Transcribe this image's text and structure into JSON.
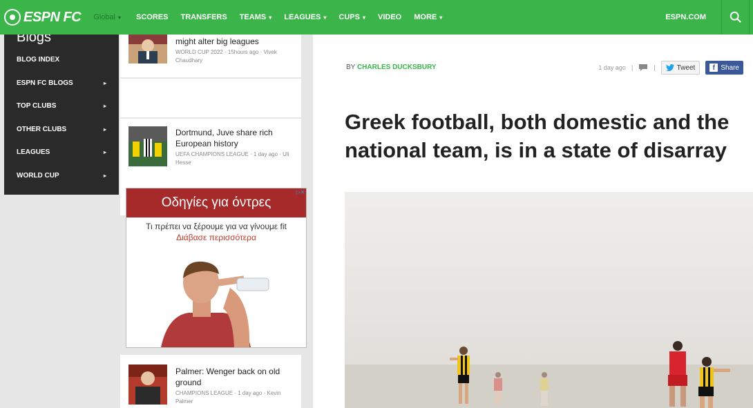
{
  "topbar": {
    "logo_text": "ESPN FC",
    "edition": "Global",
    "nav": [
      {
        "label": "SCORES",
        "dropdown": false
      },
      {
        "label": "TRANSFERS",
        "dropdown": false
      },
      {
        "label": "TEAMS",
        "dropdown": true
      },
      {
        "label": "LEAGUES",
        "dropdown": true
      },
      {
        "label": "CUPS",
        "dropdown": true
      },
      {
        "label": "VIDEO",
        "dropdown": false
      },
      {
        "label": "MORE",
        "dropdown": true
      }
    ],
    "espn_link": "ESPN.COM",
    "accent_color": "#3bb54a"
  },
  "sidebar": {
    "title": "Blogs",
    "items": [
      {
        "label": "BLOG INDEX",
        "arrow": false
      },
      {
        "label": "ESPN FC BLOGS",
        "arrow": true
      },
      {
        "label": "TOP CLUBS",
        "arrow": true
      },
      {
        "label": "OTHER CLUBS",
        "arrow": true
      },
      {
        "label": "LEAGUES",
        "arrow": true
      },
      {
        "label": "WORLD CUP",
        "arrow": true
      }
    ]
  },
  "stories": [
    {
      "title": "might alter big leagues",
      "meta": "WORLD CUP 2022 · 15hours ago · Vivek Chaudhary"
    },
    {
      "title": "Dortmund, Juve share rich European history",
      "meta": "UEFA CHAMPIONS LEAGUE · 1 day ago · Uli Hesse"
    },
    {
      "title": "Palmer: Wenger back on old ground",
      "meta": "CHAMPIONS LEAGUE · 1 day ago · Kevin Palmer"
    }
  ],
  "ad": {
    "header": "Οδηγίες για όντρες",
    "sub": "Τι πρέπει να ξέρουμε για να γίνουμε fit",
    "cta": "Διάβασε περισσότερα"
  },
  "article": {
    "by_prefix": "BY",
    "author": "CHARLES DUCKSBURY",
    "time": "1 day ago",
    "separator": "|",
    "tweet_label": "Tweet",
    "share_label": "Share",
    "headline": "Greek football, both domestic and the national team, is in a state of disarray"
  }
}
